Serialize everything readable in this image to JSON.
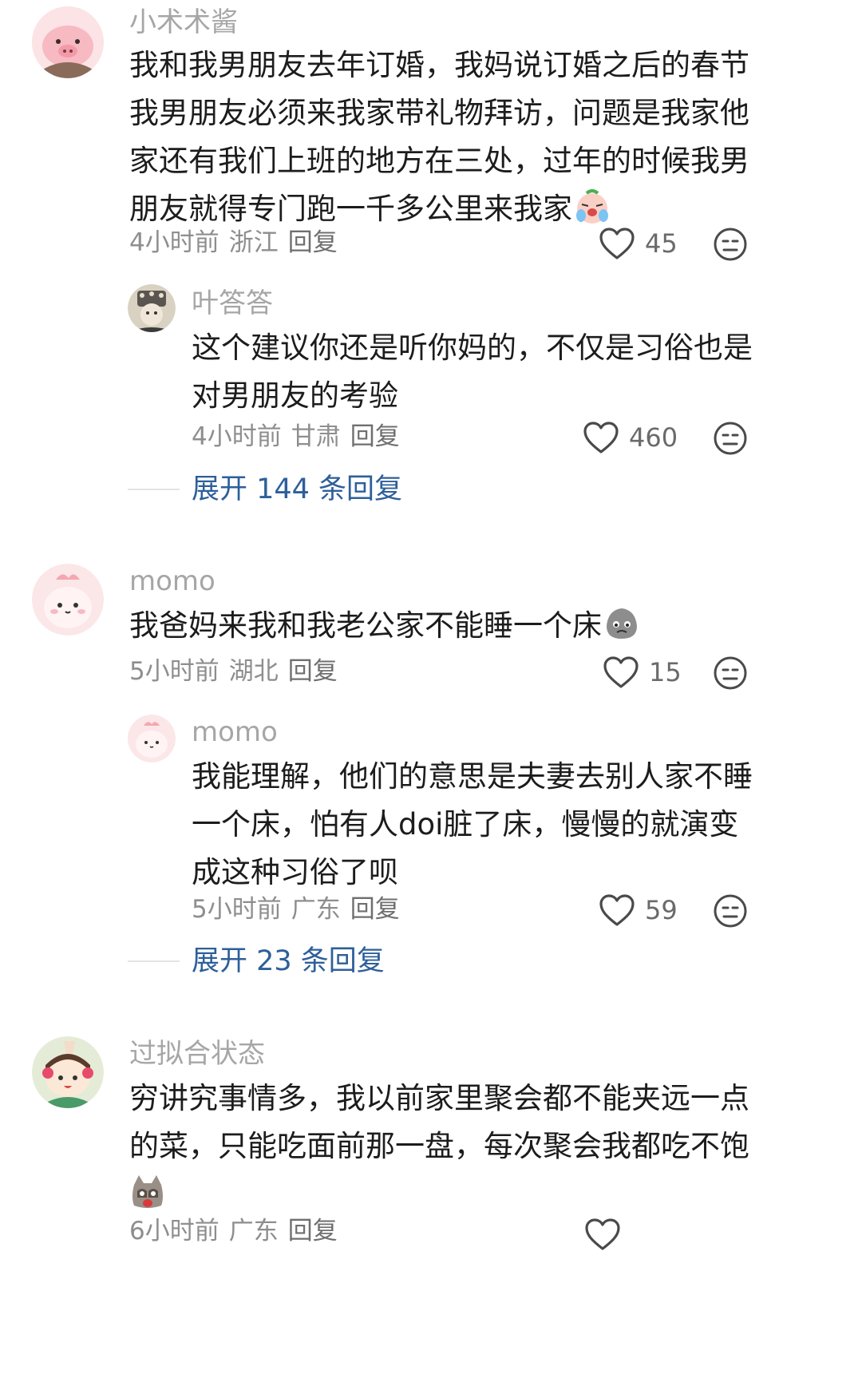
{
  "comments": [
    {
      "user": "小术术酱",
      "lines": [
        "我和我男朋友去年订婚，我妈说订婚之后的春节",
        "我男朋友必须来我家带礼物拜访，问题是我家他",
        "家还有我们上班的地方在三处，过年的时候我男",
        "朋友就得专门跑一千多公里来我家"
      ],
      "time": "4小时前",
      "location": "浙江",
      "reply": "回复",
      "likes": "45"
    },
    {
      "user": "叶答答",
      "lines": [
        "这个建议你还是听你妈的，不仅是习俗也是",
        "对男朋友的考验"
      ],
      "time": "4小时前",
      "location": "甘肃",
      "reply": "回复",
      "likes": "460"
    },
    {
      "user": "momo",
      "lines": [
        "我爸妈来我和我老公家不能睡一个床"
      ],
      "time": "5小时前",
      "location": "湖北",
      "reply": "回复",
      "likes": "15"
    },
    {
      "user": "momo",
      "lines": [
        "我能理解，他们的意思是夫妻去别人家不睡",
        "一个床，怕有人doi脏了床，慢慢的就演变",
        "成这种习俗了呗"
      ],
      "time": "5小时前",
      "location": "广东",
      "reply": "回复",
      "likes": "59"
    },
    {
      "user": "过拟合状态",
      "lines": [
        "穷讲究事情多，我以前家里聚会都不能夹远一点",
        "的菜，只能吃面前那一盘，每次聚会我都吃不饱"
      ],
      "time": "6小时前",
      "location": "广东",
      "reply": "回复",
      "likes": ""
    }
  ],
  "expand": [
    "展开 144 条回复",
    "展开 23 条回复"
  ],
  "icons": {
    "like": "heart-outline-icon",
    "dislike": "unamused-face-icon",
    "emoji_1": "crying-face-emoji",
    "emoji_2": "grey-blob-emoji",
    "emoji_3": "shocked-cat-emoji"
  },
  "colors": {
    "username": "#a6a6a6",
    "body_text": "#1c1c1c",
    "meta": "#8e8e8e",
    "expand_link": "#2d5f9a"
  }
}
